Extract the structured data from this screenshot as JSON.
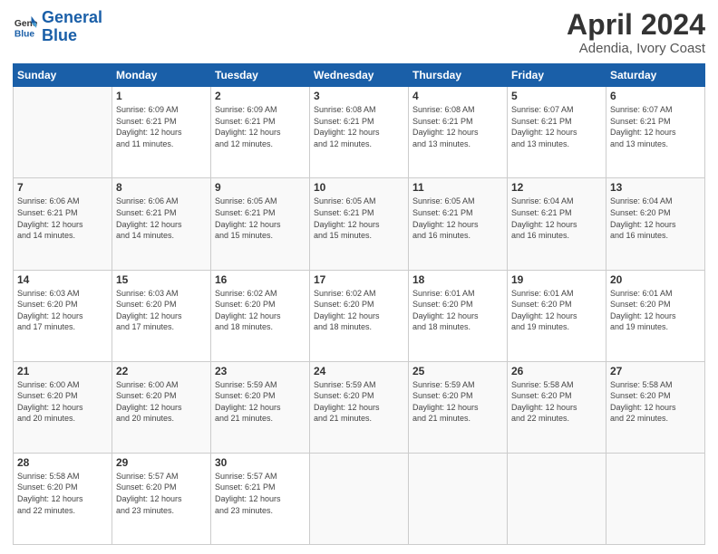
{
  "logo": {
    "text_general": "General",
    "text_blue": "Blue"
  },
  "header": {
    "month": "April 2024",
    "location": "Adendia, Ivory Coast"
  },
  "weekdays": [
    "Sunday",
    "Monday",
    "Tuesday",
    "Wednesday",
    "Thursday",
    "Friday",
    "Saturday"
  ],
  "weeks": [
    [
      {
        "day": "",
        "info": ""
      },
      {
        "day": "1",
        "info": "Sunrise: 6:09 AM\nSunset: 6:21 PM\nDaylight: 12 hours\nand 11 minutes."
      },
      {
        "day": "2",
        "info": "Sunrise: 6:09 AM\nSunset: 6:21 PM\nDaylight: 12 hours\nand 12 minutes."
      },
      {
        "day": "3",
        "info": "Sunrise: 6:08 AM\nSunset: 6:21 PM\nDaylight: 12 hours\nand 12 minutes."
      },
      {
        "day": "4",
        "info": "Sunrise: 6:08 AM\nSunset: 6:21 PM\nDaylight: 12 hours\nand 13 minutes."
      },
      {
        "day": "5",
        "info": "Sunrise: 6:07 AM\nSunset: 6:21 PM\nDaylight: 12 hours\nand 13 minutes."
      },
      {
        "day": "6",
        "info": "Sunrise: 6:07 AM\nSunset: 6:21 PM\nDaylight: 12 hours\nand 13 minutes."
      }
    ],
    [
      {
        "day": "7",
        "info": "Sunrise: 6:06 AM\nSunset: 6:21 PM\nDaylight: 12 hours\nand 14 minutes."
      },
      {
        "day": "8",
        "info": "Sunrise: 6:06 AM\nSunset: 6:21 PM\nDaylight: 12 hours\nand 14 minutes."
      },
      {
        "day": "9",
        "info": "Sunrise: 6:05 AM\nSunset: 6:21 PM\nDaylight: 12 hours\nand 15 minutes."
      },
      {
        "day": "10",
        "info": "Sunrise: 6:05 AM\nSunset: 6:21 PM\nDaylight: 12 hours\nand 15 minutes."
      },
      {
        "day": "11",
        "info": "Sunrise: 6:05 AM\nSunset: 6:21 PM\nDaylight: 12 hours\nand 16 minutes."
      },
      {
        "day": "12",
        "info": "Sunrise: 6:04 AM\nSunset: 6:21 PM\nDaylight: 12 hours\nand 16 minutes."
      },
      {
        "day": "13",
        "info": "Sunrise: 6:04 AM\nSunset: 6:20 PM\nDaylight: 12 hours\nand 16 minutes."
      }
    ],
    [
      {
        "day": "14",
        "info": "Sunrise: 6:03 AM\nSunset: 6:20 PM\nDaylight: 12 hours\nand 17 minutes."
      },
      {
        "day": "15",
        "info": "Sunrise: 6:03 AM\nSunset: 6:20 PM\nDaylight: 12 hours\nand 17 minutes."
      },
      {
        "day": "16",
        "info": "Sunrise: 6:02 AM\nSunset: 6:20 PM\nDaylight: 12 hours\nand 18 minutes."
      },
      {
        "day": "17",
        "info": "Sunrise: 6:02 AM\nSunset: 6:20 PM\nDaylight: 12 hours\nand 18 minutes."
      },
      {
        "day": "18",
        "info": "Sunrise: 6:01 AM\nSunset: 6:20 PM\nDaylight: 12 hours\nand 18 minutes."
      },
      {
        "day": "19",
        "info": "Sunrise: 6:01 AM\nSunset: 6:20 PM\nDaylight: 12 hours\nand 19 minutes."
      },
      {
        "day": "20",
        "info": "Sunrise: 6:01 AM\nSunset: 6:20 PM\nDaylight: 12 hours\nand 19 minutes."
      }
    ],
    [
      {
        "day": "21",
        "info": "Sunrise: 6:00 AM\nSunset: 6:20 PM\nDaylight: 12 hours\nand 20 minutes."
      },
      {
        "day": "22",
        "info": "Sunrise: 6:00 AM\nSunset: 6:20 PM\nDaylight: 12 hours\nand 20 minutes."
      },
      {
        "day": "23",
        "info": "Sunrise: 5:59 AM\nSunset: 6:20 PM\nDaylight: 12 hours\nand 21 minutes."
      },
      {
        "day": "24",
        "info": "Sunrise: 5:59 AM\nSunset: 6:20 PM\nDaylight: 12 hours\nand 21 minutes."
      },
      {
        "day": "25",
        "info": "Sunrise: 5:59 AM\nSunset: 6:20 PM\nDaylight: 12 hours\nand 21 minutes."
      },
      {
        "day": "26",
        "info": "Sunrise: 5:58 AM\nSunset: 6:20 PM\nDaylight: 12 hours\nand 22 minutes."
      },
      {
        "day": "27",
        "info": "Sunrise: 5:58 AM\nSunset: 6:20 PM\nDaylight: 12 hours\nand 22 minutes."
      }
    ],
    [
      {
        "day": "28",
        "info": "Sunrise: 5:58 AM\nSunset: 6:20 PM\nDaylight: 12 hours\nand 22 minutes."
      },
      {
        "day": "29",
        "info": "Sunrise: 5:57 AM\nSunset: 6:20 PM\nDaylight: 12 hours\nand 23 minutes."
      },
      {
        "day": "30",
        "info": "Sunrise: 5:57 AM\nSunset: 6:21 PM\nDaylight: 12 hours\nand 23 minutes."
      },
      {
        "day": "",
        "info": ""
      },
      {
        "day": "",
        "info": ""
      },
      {
        "day": "",
        "info": ""
      },
      {
        "day": "",
        "info": ""
      }
    ]
  ]
}
